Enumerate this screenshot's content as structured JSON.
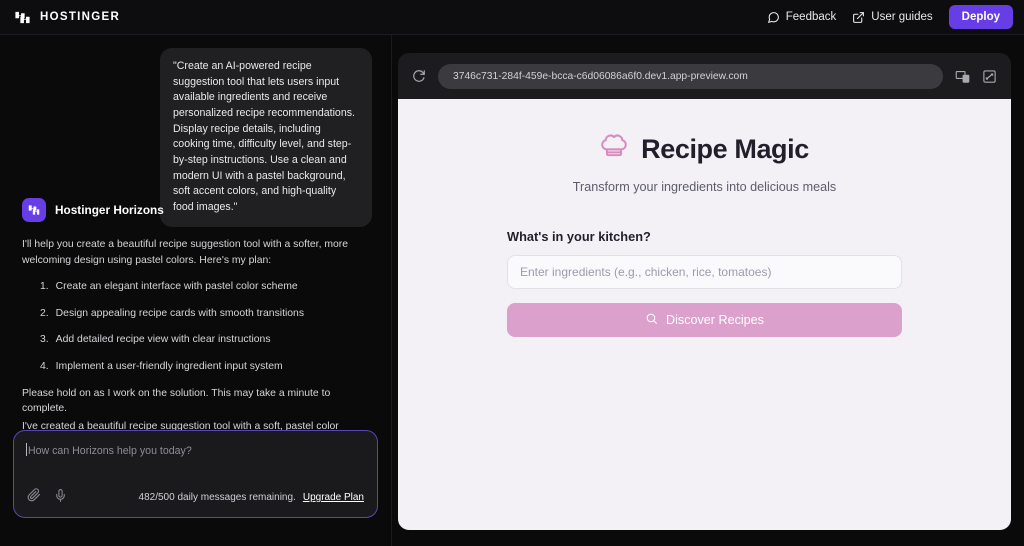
{
  "topbar": {
    "brand_name": "HOSTINGER",
    "brand_logo_icon": "hostinger-h-logo",
    "feedback_label": "Feedback",
    "feedback_icon": "speech-bubble-icon",
    "user_guides_label": "User guides",
    "user_guides_icon": "external-link-icon",
    "deploy_label": "Deploy",
    "deploy_color": "#673de6"
  },
  "chat": {
    "user_message": "\"Create an AI-powered recipe suggestion tool that lets users input available ingredients and receive personalized recipe recommendations. Display recipe details, including cooking time, difficulty level, and step-by-step instructions. Use a clean and modern UI with a pastel background, soft accent colors, and high-quality food images.\"",
    "assistant_name": "Hostinger Horizons",
    "assistant_avatar_icon": "hostinger-horizons-logo",
    "assistant_intro": "I'll help you create a beautiful recipe suggestion tool with a softer, more welcoming design using pastel colors. Here's my plan:",
    "plan": [
      {
        "num": "1.",
        "text": "Create an elegant interface with pastel color scheme"
      },
      {
        "num": "2.",
        "text": "Design appealing recipe cards with smooth transitions"
      },
      {
        "num": "3.",
        "text": "Add detailed recipe view with clear instructions"
      },
      {
        "num": "4.",
        "text": "Implement a user-friendly ingredient input system"
      }
    ],
    "assistant_hold": "Please hold on as I work on the solution. This may take a minute to complete.",
    "assistant_done": "I've created a beautiful recipe suggestion tool with a soft, pastel color scheme. Here's what you can do with it:",
    "input_placeholder": "How can Horizons help you today?",
    "attach_icon": "paperclip-icon",
    "mic_icon": "microphone-icon",
    "quota_text": "482/500 daily messages remaining.",
    "upgrade_label": "Upgrade Plan"
  },
  "preview": {
    "reload_icon": "reload-icon",
    "url": "3746c731-284f-459e-bcca-c6d06086a6f0.dev1.app-preview.com",
    "responsive_icon": "device-toggle-icon",
    "fullscreen_icon": "fullscreen-icon"
  },
  "app": {
    "logo_icon": "chef-hat-icon",
    "logo_color": "#d98bbf",
    "title": "Recipe Magic",
    "subtitle": "Transform your ingredients into delicious meals",
    "form_label": "What's in your kitchen?",
    "input_placeholder": "Enter ingredients (e.g., chicken, rice, tomatoes)",
    "button_label": "Discover Recipes",
    "button_icon": "search-icon",
    "button_color": "#dca0cc",
    "background_color": "#f3f1f6"
  }
}
